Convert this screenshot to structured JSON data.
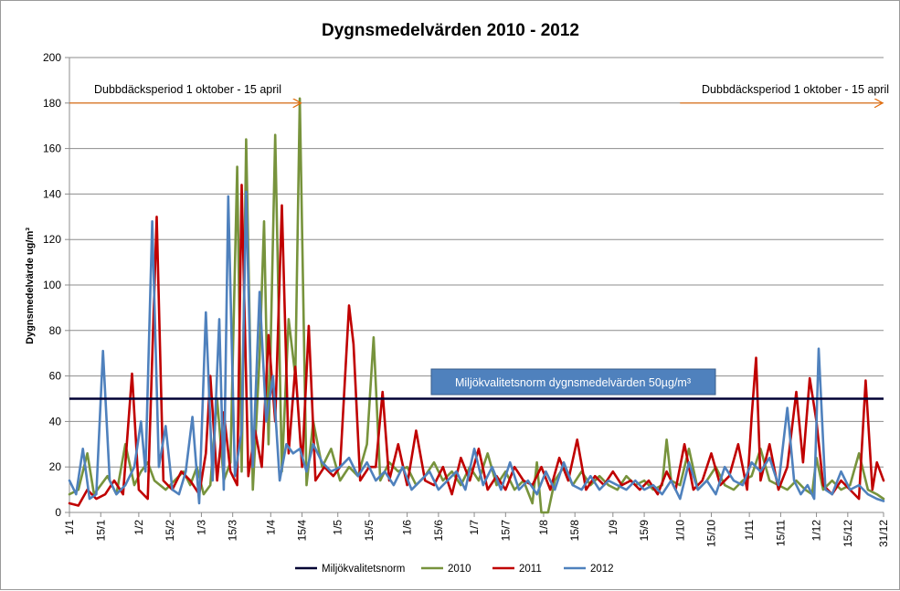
{
  "chart_data": {
    "type": "line",
    "title": "Dygnsmedelvärden 2010 - 2012",
    "ylabel": "Dygnsmedelvärde ug/m³",
    "xlabel": "",
    "ylim": [
      0,
      200
    ],
    "yticks": [
      0,
      20,
      40,
      60,
      80,
      100,
      120,
      140,
      160,
      180,
      200
    ],
    "grid": true,
    "legend_position": "bottom",
    "categories": [
      "1/1",
      "15/1",
      "1/2",
      "15/2",
      "1/3",
      "15/3",
      "1/4",
      "15/4",
      "1/5",
      "15/5",
      "1/6",
      "15/6",
      "1/7",
      "15/7",
      "1/8",
      "15/8",
      "1/9",
      "15/9",
      "1/10",
      "15/10",
      "1/11",
      "15/11",
      "1/12",
      "15/12",
      "31/12"
    ],
    "category_days": [
      1,
      15,
      32,
      46,
      60,
      74,
      91,
      105,
      121,
      135,
      152,
      166,
      182,
      196,
      213,
      227,
      244,
      258,
      274,
      288,
      305,
      319,
      335,
      349,
      365
    ],
    "norm": {
      "name": "Miljökvalitetsnorm",
      "value": 50,
      "label": "Miljökvalitetsnorm dygnsmedelvärden 50µg/m³",
      "color": "#000033"
    },
    "annotations": [
      {
        "text": "Dubbdäcksperiod 1 oktober - 15 april",
        "arrow_from_day": 1,
        "arrow_to_day": 105,
        "y": 180
      },
      {
        "text": "Dubbdäcksperiod 1 oktober - 15 april",
        "arrow_from_day": 274,
        "arrow_to_day": 365,
        "y": 180
      }
    ],
    "series": [
      {
        "name": "2010",
        "color": "#77933c",
        "points": [
          [
            1,
            8
          ],
          [
            5,
            10
          ],
          [
            9,
            26
          ],
          [
            12,
            8
          ],
          [
            18,
            16
          ],
          [
            22,
            8
          ],
          [
            26,
            30
          ],
          [
            30,
            12
          ],
          [
            33,
            18
          ],
          [
            36,
            22
          ],
          [
            39,
            14
          ],
          [
            44,
            10
          ],
          [
            48,
            14
          ],
          [
            52,
            18
          ],
          [
            55,
            12
          ],
          [
            58,
            20
          ],
          [
            61,
            8
          ],
          [
            64,
            12
          ],
          [
            67,
            50
          ],
          [
            70,
            14
          ],
          [
            73,
            22
          ],
          [
            76,
            152
          ],
          [
            78,
            18
          ],
          [
            80,
            164
          ],
          [
            83,
            10
          ],
          [
            86,
            68
          ],
          [
            88,
            128
          ],
          [
            90,
            30
          ],
          [
            93,
            166
          ],
          [
            96,
            18
          ],
          [
            99,
            85
          ],
          [
            102,
            60
          ],
          [
            104,
            182
          ],
          [
            107,
            12
          ],
          [
            110,
            40
          ],
          [
            114,
            20
          ],
          [
            118,
            28
          ],
          [
            122,
            14
          ],
          [
            126,
            20
          ],
          [
            130,
            16
          ],
          [
            134,
            30
          ],
          [
            137,
            77
          ],
          [
            140,
            14
          ],
          [
            144,
            22
          ],
          [
            148,
            18
          ],
          [
            152,
            20
          ],
          [
            156,
            12
          ],
          [
            160,
            16
          ],
          [
            164,
            22
          ],
          [
            168,
            14
          ],
          [
            172,
            18
          ],
          [
            176,
            12
          ],
          [
            180,
            20
          ],
          [
            184,
            14
          ],
          [
            188,
            26
          ],
          [
            192,
            12
          ],
          [
            196,
            18
          ],
          [
            200,
            10
          ],
          [
            204,
            14
          ],
          [
            208,
            4
          ],
          [
            210,
            22
          ],
          [
            212,
            0
          ],
          [
            215,
            0
          ],
          [
            218,
            14
          ],
          [
            222,
            20
          ],
          [
            226,
            12
          ],
          [
            230,
            18
          ],
          [
            234,
            12
          ],
          [
            238,
            16
          ],
          [
            242,
            12
          ],
          [
            246,
            10
          ],
          [
            250,
            16
          ],
          [
            254,
            12
          ],
          [
            258,
            14
          ],
          [
            262,
            10
          ],
          [
            266,
            12
          ],
          [
            268,
            32
          ],
          [
            270,
            14
          ],
          [
            274,
            12
          ],
          [
            278,
            28
          ],
          [
            282,
            10
          ],
          [
            286,
            14
          ],
          [
            290,
            20
          ],
          [
            294,
            12
          ],
          [
            298,
            10
          ],
          [
            302,
            14
          ],
          [
            306,
            16
          ],
          [
            310,
            28
          ],
          [
            314,
            14
          ],
          [
            318,
            12
          ],
          [
            322,
            10
          ],
          [
            326,
            14
          ],
          [
            330,
            10
          ],
          [
            333,
            8
          ],
          [
            335,
            24
          ],
          [
            338,
            10
          ],
          [
            342,
            14
          ],
          [
            346,
            10
          ],
          [
            350,
            12
          ],
          [
            354,
            26
          ],
          [
            358,
            10
          ],
          [
            362,
            8
          ],
          [
            365,
            6
          ]
        ]
      },
      {
        "name": "2011",
        "color": "#c00000",
        "points": [
          [
            1,
            4
          ],
          [
            5,
            3
          ],
          [
            9,
            10
          ],
          [
            13,
            6
          ],
          [
            17,
            8
          ],
          [
            21,
            14
          ],
          [
            25,
            8
          ],
          [
            29,
            61
          ],
          [
            32,
            10
          ],
          [
            36,
            6
          ],
          [
            40,
            130
          ],
          [
            43,
            14
          ],
          [
            47,
            10
          ],
          [
            51,
            18
          ],
          [
            55,
            14
          ],
          [
            59,
            8
          ],
          [
            62,
            26
          ],
          [
            64,
            60
          ],
          [
            67,
            14
          ],
          [
            70,
            44
          ],
          [
            73,
            18
          ],
          [
            76,
            12
          ],
          [
            78,
            144
          ],
          [
            81,
            16
          ],
          [
            84,
            36
          ],
          [
            87,
            20
          ],
          [
            90,
            78
          ],
          [
            93,
            40
          ],
          [
            96,
            135
          ],
          [
            99,
            26
          ],
          [
            102,
            64
          ],
          [
            105,
            20
          ],
          [
            108,
            82
          ],
          [
            111,
            14
          ],
          [
            115,
            20
          ],
          [
            119,
            16
          ],
          [
            122,
            20
          ],
          [
            126,
            91
          ],
          [
            128,
            74
          ],
          [
            131,
            14
          ],
          [
            135,
            20
          ],
          [
            138,
            20
          ],
          [
            141,
            53
          ],
          [
            144,
            14
          ],
          [
            148,
            30
          ],
          [
            152,
            12
          ],
          [
            156,
            36
          ],
          [
            160,
            14
          ],
          [
            164,
            12
          ],
          [
            168,
            20
          ],
          [
            172,
            8
          ],
          [
            176,
            24
          ],
          [
            180,
            14
          ],
          [
            184,
            28
          ],
          [
            188,
            10
          ],
          [
            192,
            16
          ],
          [
            196,
            10
          ],
          [
            200,
            20
          ],
          [
            204,
            14
          ],
          [
            208,
            12
          ],
          [
            212,
            20
          ],
          [
            216,
            10
          ],
          [
            220,
            24
          ],
          [
            224,
            14
          ],
          [
            228,
            32
          ],
          [
            232,
            10
          ],
          [
            236,
            16
          ],
          [
            240,
            12
          ],
          [
            244,
            18
          ],
          [
            248,
            12
          ],
          [
            252,
            14
          ],
          [
            256,
            10
          ],
          [
            260,
            14
          ],
          [
            264,
            8
          ],
          [
            268,
            18
          ],
          [
            272,
            10
          ],
          [
            276,
            30
          ],
          [
            280,
            10
          ],
          [
            284,
            14
          ],
          [
            288,
            26
          ],
          [
            292,
            12
          ],
          [
            296,
            16
          ],
          [
            300,
            30
          ],
          [
            304,
            10
          ],
          [
            306,
            42
          ],
          [
            308,
            68
          ],
          [
            310,
            14
          ],
          [
            314,
            30
          ],
          [
            318,
            10
          ],
          [
            322,
            20
          ],
          [
            326,
            53
          ],
          [
            329,
            22
          ],
          [
            332,
            59
          ],
          [
            335,
            40
          ],
          [
            338,
            12
          ],
          [
            342,
            8
          ],
          [
            346,
            14
          ],
          [
            350,
            10
          ],
          [
            354,
            6
          ],
          [
            357,
            58
          ],
          [
            360,
            10
          ],
          [
            362,
            22
          ],
          [
            365,
            14
          ]
        ]
      },
      {
        "name": "2012",
        "color": "#4f81bd",
        "points": [
          [
            1,
            14
          ],
          [
            4,
            8
          ],
          [
            7,
            28
          ],
          [
            10,
            6
          ],
          [
            13,
            8
          ],
          [
            16,
            71
          ],
          [
            19,
            14
          ],
          [
            22,
            8
          ],
          [
            26,
            12
          ],
          [
            30,
            20
          ],
          [
            33,
            40
          ],
          [
            35,
            18
          ],
          [
            38,
            128
          ],
          [
            41,
            20
          ],
          [
            44,
            38
          ],
          [
            47,
            10
          ],
          [
            50,
            8
          ],
          [
            53,
            18
          ],
          [
            56,
            42
          ],
          [
            59,
            4
          ],
          [
            62,
            88
          ],
          [
            65,
            14
          ],
          [
            68,
            85
          ],
          [
            70,
            10
          ],
          [
            72,
            139
          ],
          [
            75,
            16
          ],
          [
            78,
            36
          ],
          [
            80,
            141
          ],
          [
            83,
            20
          ],
          [
            86,
            97
          ],
          [
            89,
            40
          ],
          [
            92,
            60
          ],
          [
            95,
            14
          ],
          [
            98,
            30
          ],
          [
            101,
            26
          ],
          [
            104,
            28
          ],
          [
            107,
            18
          ],
          [
            110,
            30
          ],
          [
            114,
            22
          ],
          [
            118,
            18
          ],
          [
            122,
            20
          ],
          [
            126,
            24
          ],
          [
            130,
            16
          ],
          [
            134,
            22
          ],
          [
            138,
            14
          ],
          [
            142,
            18
          ],
          [
            146,
            12
          ],
          [
            150,
            20
          ],
          [
            154,
            10
          ],
          [
            158,
            14
          ],
          [
            162,
            18
          ],
          [
            166,
            10
          ],
          [
            170,
            14
          ],
          [
            174,
            18
          ],
          [
            178,
            10
          ],
          [
            182,
            28
          ],
          [
            186,
            12
          ],
          [
            190,
            20
          ],
          [
            194,
            10
          ],
          [
            198,
            22
          ],
          [
            202,
            10
          ],
          [
            206,
            14
          ],
          [
            210,
            8
          ],
          [
            214,
            18
          ],
          [
            218,
            10
          ],
          [
            222,
            22
          ],
          [
            226,
            12
          ],
          [
            230,
            10
          ],
          [
            234,
            16
          ],
          [
            238,
            10
          ],
          [
            242,
            14
          ],
          [
            246,
            12
          ],
          [
            250,
            10
          ],
          [
            254,
            14
          ],
          [
            258,
            10
          ],
          [
            262,
            12
          ],
          [
            266,
            8
          ],
          [
            270,
            14
          ],
          [
            274,
            6
          ],
          [
            278,
            22
          ],
          [
            282,
            10
          ],
          [
            286,
            14
          ],
          [
            290,
            8
          ],
          [
            294,
            20
          ],
          [
            298,
            14
          ],
          [
            302,
            12
          ],
          [
            306,
            22
          ],
          [
            310,
            18
          ],
          [
            314,
            24
          ],
          [
            318,
            12
          ],
          [
            322,
            46
          ],
          [
            325,
            14
          ],
          [
            328,
            8
          ],
          [
            331,
            12
          ],
          [
            334,
            6
          ],
          [
            336,
            72
          ],
          [
            339,
            10
          ],
          [
            342,
            8
          ],
          [
            346,
            18
          ],
          [
            350,
            10
          ],
          [
            354,
            12
          ],
          [
            358,
            8
          ],
          [
            362,
            6
          ],
          [
            365,
            5
          ]
        ]
      }
    ]
  }
}
